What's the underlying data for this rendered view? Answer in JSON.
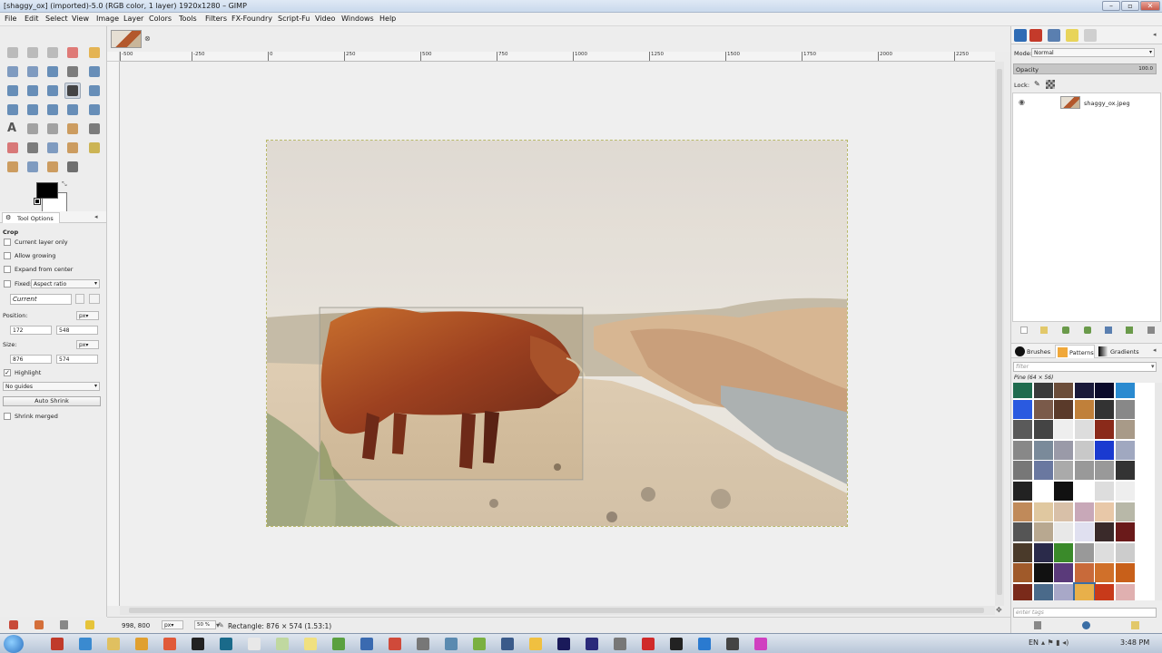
{
  "window": {
    "title": "[shaggy_ox] (imported)-5.0 (RGB color, 1 layer) 1920x1280 – GIMP"
  },
  "menu": [
    "File",
    "Edit",
    "Select",
    "View",
    "Image",
    "Layer",
    "Colors",
    "Tools",
    "Filters",
    "FX-Foundry",
    "Script-Fu",
    "Video",
    "Windows",
    "Help"
  ],
  "tool_options": {
    "tab_label": "Tool Options",
    "tool_name": "Crop",
    "current_layer_only": "Current layer only",
    "allow_growing": "Allow growing",
    "expand_from_center": "Expand from center",
    "fixed_label": "Fixed:",
    "fixed_value": "Aspect ratio",
    "current_value": "Current",
    "position_label": "Position:",
    "position_unit": "px",
    "position_x": "172",
    "position_y": "548",
    "size_label": "Size:",
    "size_unit": "px",
    "size_w": "876",
    "size_h": "574",
    "highlight": "Highlight",
    "guides": "No guides",
    "auto_shrink": "Auto Shrink",
    "shrink_merged": "Shrink merged"
  },
  "ruler_top": [
    "-500",
    "-250",
    "0",
    "250",
    "500",
    "750",
    "1000",
    "1250",
    "1500",
    "1750",
    "2000",
    "2250"
  ],
  "status": {
    "coords": "998, 800",
    "unit": "px",
    "zoom": "50 %",
    "message": "Rectangle: 876 × 574 (1.53:1)"
  },
  "layers": {
    "mode_label": "Mode:",
    "mode_value": "Normal",
    "opacity_label": "Opacity",
    "opacity_value": "100.0",
    "lock_label": "Lock:",
    "layer_name": "shaggy_ox.jpeg"
  },
  "brushes_panel": {
    "tab_brushes": "Brushes",
    "tab_patterns": "Patterns",
    "tab_gradients": "Gradients",
    "filter_placeholder": "filter",
    "pattern_name": "Pine (64 × 56)",
    "tags_placeholder": "enter tags"
  },
  "taskbar": {
    "lang": "EN",
    "time": "3:48 PM"
  },
  "colors": {
    "accent": "#3a6ea5",
    "fg": "#000000",
    "bg": "#ffffff"
  }
}
